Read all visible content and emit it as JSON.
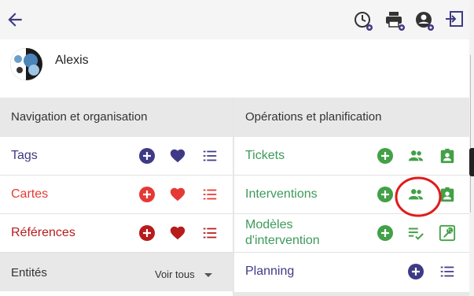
{
  "user": {
    "name": "Alexis"
  },
  "left_panel": {
    "title": "Navigation et organisation",
    "rows": [
      {
        "label": "Tags",
        "color": "#3f3a86"
      },
      {
        "label": "Cartes",
        "color": "#e53935"
      },
      {
        "label": "Références",
        "color": "#b71c1c"
      }
    ],
    "entities": {
      "label": "Entités",
      "filter": "Voir tous"
    }
  },
  "right_panel": {
    "title": "Opérations et planification",
    "rows": [
      {
        "label": "Tickets",
        "color": "#3c9b5a"
      },
      {
        "label": "Interventions",
        "color": "#3c9b5a"
      },
      {
        "label_line1": "Modèles",
        "label_line2": "d'intervention",
        "color": "#3c9b5a"
      },
      {
        "label": "Planning",
        "color": "#3f3a86"
      }
    ]
  },
  "colors": {
    "purple": "#3f3a86",
    "red": "#e53935",
    "darkred": "#b71c1c",
    "green": "#43a047",
    "highlight": "#e01b1b"
  },
  "icons": [
    "arrow-left-icon",
    "clock-settings-icon",
    "printer-settings-icon",
    "user-settings-icon",
    "exit-icon",
    "add-circle-icon",
    "heart-icon",
    "list-icon",
    "people-icon",
    "badge-icon",
    "checklist-icon",
    "wrench-icon"
  ]
}
